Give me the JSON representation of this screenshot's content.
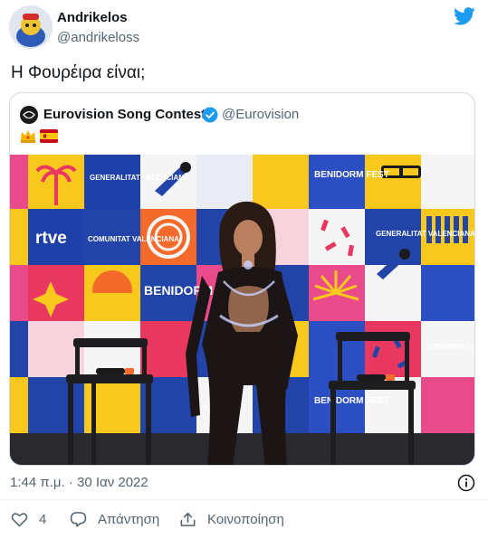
{
  "tweet": {
    "author_name": "Andrikelos",
    "author_handle": "@andrikeloss",
    "text": "Η Φουρέιρα είναι;",
    "timestamp": "1:44 π.μ. · 30 Ιαν 2022"
  },
  "quote": {
    "author_name": "Eurovision Song Contest",
    "author_handle": "@Eurovision",
    "emojis": [
      "crown-emoji",
      "spain-flag-emoji"
    ],
    "photo_texts": {
      "generalitat": "GENERALITAT VALENCIANA",
      "rtve": "rtve",
      "comunitat": "COMUNITAT VALENCIANA",
      "benidorm_fest": "BENIDORM FEST",
      "benidorm": "BENIDORM"
    }
  },
  "actions": {
    "like_count": "4",
    "reply_label": "Απάντηση",
    "share_label": "Κοινοποίηση"
  },
  "colors": {
    "twitter_blue": "#1d9bf0",
    "secondary_text": "#536471",
    "border": "#cfd9de"
  }
}
